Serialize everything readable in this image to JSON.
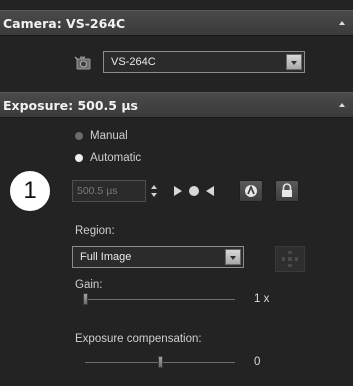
{
  "camera_section": {
    "title": "Camera: VS-264C",
    "selected_camera": "VS-264C"
  },
  "exposure_section": {
    "title": "Exposure: 500.5 µs",
    "modes": [
      {
        "label": "Manual",
        "selected": false
      },
      {
        "label": "Automatic",
        "selected": true
      }
    ],
    "exposure_value": "500.5 µs",
    "callout_number": "1"
  },
  "region": {
    "label": "Region:",
    "selected": "Full Image"
  },
  "gain": {
    "label": "Gain:",
    "value_text": "1 x",
    "level": 0.0
  },
  "exposure_compensation": {
    "label": "Exposure compensation:",
    "value_text": "0",
    "level": 0.5
  },
  "colors": {
    "panel_bg": "#232323",
    "header_bg": "#404040",
    "text": "#dcdcdc"
  }
}
